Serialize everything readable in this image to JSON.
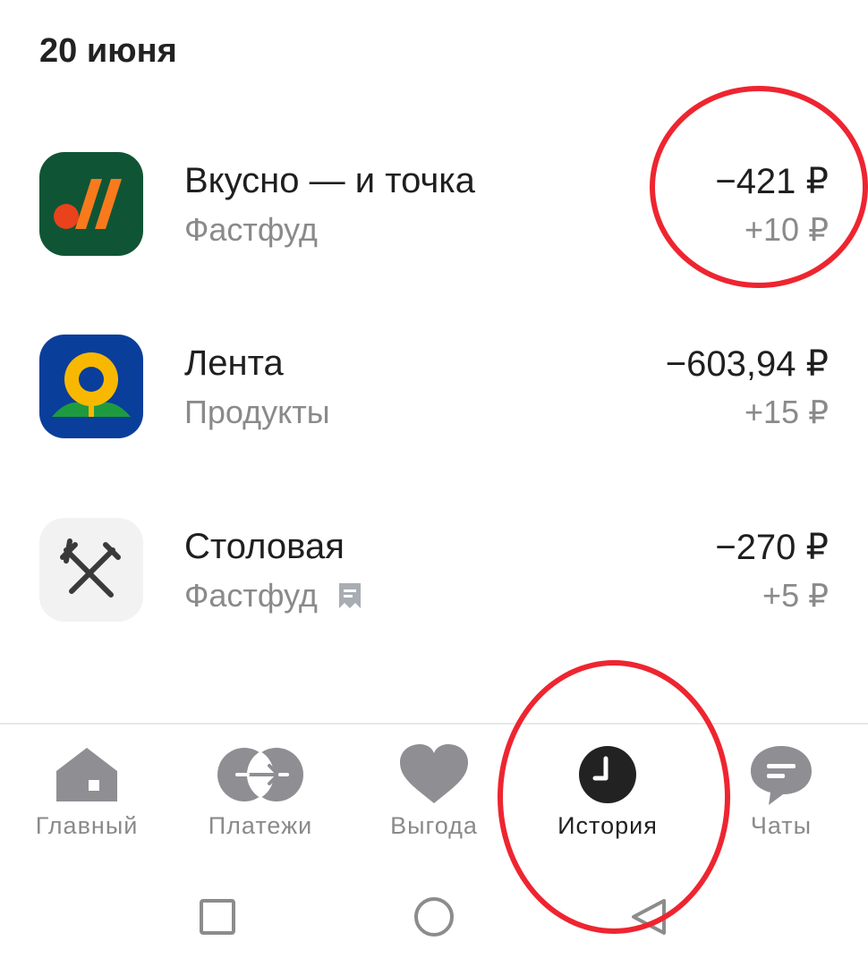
{
  "date_header": "20 июня",
  "transactions": [
    {
      "name": "Вкусно — и точка",
      "category": "Фастфуд",
      "amount": "−421 ₽",
      "cashback": "+10 ₽",
      "icon": "vkusno-logo-icon",
      "has_receipt": false
    },
    {
      "name": "Лента",
      "category": "Продукты",
      "amount": "−603,94 ₽",
      "cashback": "+15 ₽",
      "icon": "lenta-logo-icon",
      "has_receipt": false
    },
    {
      "name": "Столовая",
      "category": "Фастфуд",
      "amount": "−270 ₽",
      "cashback": "+5 ₽",
      "icon": "fork-knife-icon",
      "has_receipt": true
    }
  ],
  "tabs": [
    {
      "label": "Главный",
      "icon": "home-icon",
      "active": false
    },
    {
      "label": "Платежи",
      "icon": "transfer-icon",
      "active": false
    },
    {
      "label": "Выгода",
      "icon": "heart-icon",
      "active": false
    },
    {
      "label": "История",
      "icon": "clock-icon",
      "active": true
    },
    {
      "label": "Чаты",
      "icon": "chat-icon",
      "active": false
    }
  ],
  "system_nav": [
    "recents-button",
    "home-button",
    "back-button"
  ],
  "colors": {
    "annotation_red": "#ee2530",
    "vkusno_green": "#0f5535",
    "vkusno_orange": "#f97a1c",
    "vkusno_red": "#e9421c",
    "lenta_blue": "#0a3e9b",
    "lenta_yellow": "#f9b800",
    "lenta_green": "#1e9b3f",
    "tab_inactive": "#8e8e93",
    "tab_active": "#222222"
  }
}
